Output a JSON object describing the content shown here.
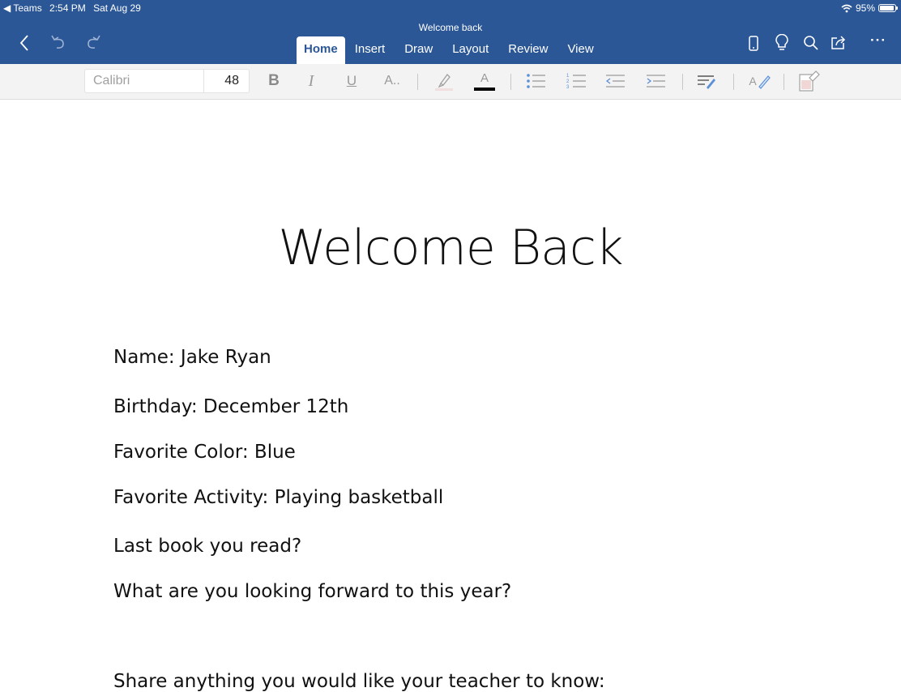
{
  "status_bar": {
    "back_app": "◀ Teams",
    "time": "2:54 PM",
    "date": "Sat Aug 29",
    "battery": "95%",
    "battery_level": 0.95
  },
  "header": {
    "doc_title": "Welcome back",
    "tabs": [
      {
        "label": "Home",
        "active": true
      },
      {
        "label": "Insert",
        "active": false
      },
      {
        "label": "Draw",
        "active": false
      },
      {
        "label": "Layout",
        "active": false
      },
      {
        "label": "Review",
        "active": false
      },
      {
        "label": "View",
        "active": false
      }
    ],
    "left_icons": [
      "back-chevron-icon",
      "undo-icon",
      "redo-icon"
    ],
    "right_icons": [
      "phone-layout-icon",
      "lightbulb-icon",
      "search-icon",
      "share-icon",
      "more-icon"
    ],
    "more_glyph": "···"
  },
  "ribbon": {
    "font_name": "Calibri",
    "font_size": "48",
    "bold_glyph": "B",
    "italic_glyph": "I",
    "underline_glyph": "U",
    "font_effects_glyph": "A..",
    "font_color_glyph": "A",
    "style_glyph": "A"
  },
  "document": {
    "heading": "Welcome Back",
    "lines": [
      "Name:  Jake Ryan",
      "Birthday: December 12th",
      "Favorite Color: Blue",
      "Favorite Activity:  Playing basketball",
      "Last book you read?",
      "What are you looking forward to this year?"
    ],
    "partial_line": "Share anything you would like your teacher to know:"
  },
  "colors": {
    "header_bg": "#2b5797",
    "ribbon_bg": "#f3f3f3",
    "text": "#111111"
  }
}
